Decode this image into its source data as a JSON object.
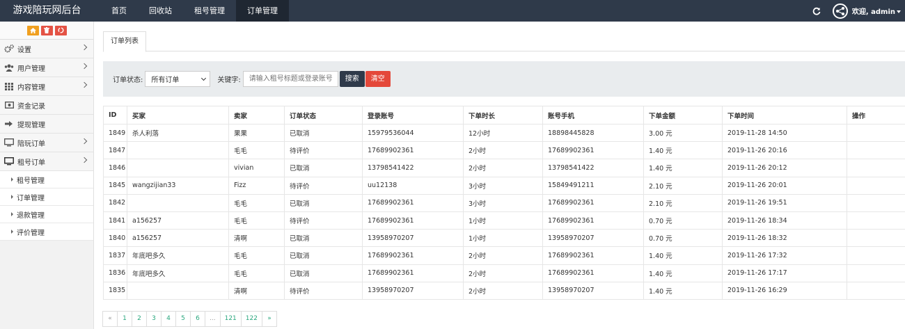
{
  "app": {
    "title": "游戏陪玩网后台"
  },
  "topnav": {
    "items": [
      {
        "label": "首页"
      },
      {
        "label": "回收站"
      },
      {
        "label": "租号管理"
      },
      {
        "label": "订单管理",
        "active": true
      }
    ]
  },
  "user": {
    "welcome": "欢迎, admin"
  },
  "sidebar": {
    "menu": [
      {
        "label": "设置",
        "icon": "gears-icon"
      },
      {
        "label": "用户管理",
        "icon": "users-icon"
      },
      {
        "label": "内容管理",
        "icon": "grid-icon"
      },
      {
        "label": "资金记录",
        "icon": "money-icon"
      },
      {
        "label": "提现管理",
        "icon": "sign-out-icon"
      },
      {
        "label": "陪玩订单",
        "icon": "desktop-icon"
      },
      {
        "label": "租号订单",
        "icon": "desktop-icon"
      }
    ],
    "submenu": [
      {
        "label": "租号管理"
      },
      {
        "label": "订单管理"
      },
      {
        "label": "退款管理"
      },
      {
        "label": "评价管理"
      }
    ]
  },
  "tab": {
    "label": "订单列表"
  },
  "filter": {
    "status_label": "订单状态:",
    "status_value": "所有订单",
    "keyword_label": "关键字:",
    "keyword_placeholder": "请输入租号标题或登录账号",
    "search_button": "搜索",
    "clear_button": "清空"
  },
  "table": {
    "headers": [
      "ID",
      "买家",
      "卖家",
      "订单状态",
      "登录账号",
      "下单时长",
      "账号手机",
      "下单金额",
      "下单时间",
      "操作"
    ],
    "rows": [
      [
        "1849",
        "杀人利落",
        "果果",
        "已取消",
        "15979536044",
        "12小时",
        "18898445828",
        "3.00 元",
        "2019-11-28 14:50",
        ""
      ],
      [
        "1847",
        "",
        "毛毛",
        "待评价",
        "17689902361",
        "2小时",
        "17689902361",
        "1.40 元",
        "2019-11-26 20:16",
        ""
      ],
      [
        "1846",
        "",
        "vivian",
        "已取消",
        "13798541422",
        "2小时",
        "13798541422",
        "1.40 元",
        "2019-11-26 20:12",
        ""
      ],
      [
        "1845",
        "wangzijian33",
        "Fizz",
        "待评价",
        "uu12138",
        "3小时",
        "15849491211",
        "2.10 元",
        "2019-11-26 20:01",
        ""
      ],
      [
        "1842",
        "",
        "毛毛",
        "已取消",
        "17689902361",
        "3小时",
        "17689902361",
        "2.10 元",
        "2019-11-26 19:51",
        ""
      ],
      [
        "1841",
        "a156257",
        "毛毛",
        "待评价",
        "17689902361",
        "1小时",
        "17689902361",
        "0.70 元",
        "2019-11-26 18:34",
        ""
      ],
      [
        "1840",
        "a156257",
        "清啊",
        "已取消",
        "13958970207",
        "1小时",
        "13958970207",
        "0.70 元",
        "2019-11-26 18:32",
        ""
      ],
      [
        "1837",
        "年底吧多久",
        "毛毛",
        "已取消",
        "17689902361",
        "2小时",
        "17689902361",
        "1.40 元",
        "2019-11-26 17:32",
        ""
      ],
      [
        "1836",
        "年底吧多久",
        "毛毛",
        "已取消",
        "17689902361",
        "2小时",
        "17689902361",
        "1.40 元",
        "2019-11-26 17:17",
        ""
      ],
      [
        "1835",
        "",
        "清啊",
        "待评价",
        "13958970207",
        "2小时",
        "13958970207",
        "1.40 元",
        "2019-11-26 16:29",
        ""
      ]
    ]
  },
  "pagination": {
    "items": [
      "«",
      "1",
      "2",
      "3",
      "4",
      "5",
      "6",
      "...",
      "121",
      "122",
      "»"
    ]
  },
  "colors": {
    "topbar": "#2f3a4a",
    "accent": "#2aa77e",
    "danger": "#e4483a",
    "shortcut_orange": "#f0a020"
  }
}
